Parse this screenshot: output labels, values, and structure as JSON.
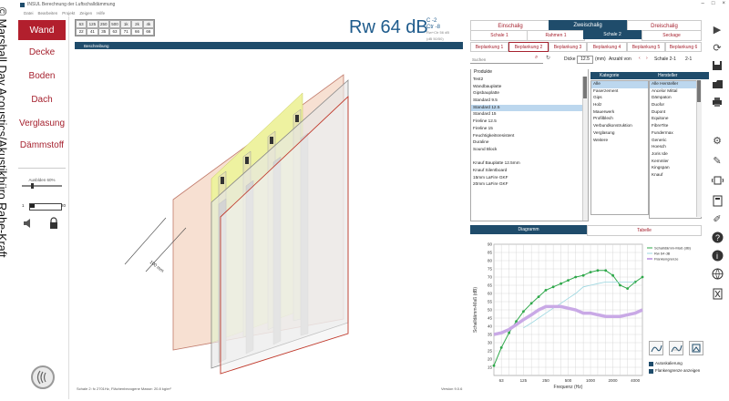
{
  "copyright": "© Marshall Day Acoustics/Akustikbüro Rahe-Kraft",
  "window": {
    "title": "INSUL Berechnung der Luftschalldämmung",
    "menu": [
      "Datei",
      "Bearbeiten",
      "Projekt",
      "Zeigen",
      "Hilfe"
    ]
  },
  "sidebar": {
    "items": [
      "Wand",
      "Decke",
      "Boden",
      "Dach",
      "Verglasung",
      "Dämmstoff"
    ],
    "slider_label": "Ausblden 60%",
    "slider2_min": "1",
    "slider2_max": "20"
  },
  "topgrid": {
    "headers": [
      "63",
      "125",
      "250",
      "500",
      "1k",
      "2k",
      "4k"
    ],
    "values": [
      "22",
      "41",
      "35",
      "63",
      "71",
      "66",
      "66"
    ]
  },
  "rating": {
    "main": "Rw 64 dB",
    "c": "C -2",
    "ctr": "Ctr -8",
    "sub": "Rw+Ctr 56 dB",
    "sub2": "(dB 50/50)"
  },
  "view3d": {
    "header": "Beschreibung",
    "dimension": "100 mm",
    "status": "Schale 2: fc 2701Hz, Flächenbezogene Masse: 20.8 kg/m²",
    "version": "Version 9.0.6"
  },
  "right": {
    "main_tabs": [
      "Einschalig",
      "Zweischalig",
      "Dreischalig"
    ],
    "sub_tabs": [
      "Schale 1",
      "Rahmen 1",
      "Schale 2",
      "Seckage"
    ],
    "layers": [
      "Beplankung 1",
      "Beplankung 2",
      "Beplankung 3",
      "Beplankung 4",
      "Beplankung 5",
      "Beplankung 6"
    ],
    "search_placeholder": "Suchen",
    "dicke_label": "Dicke",
    "dicke_value": "12.5",
    "dicke_unit": "(mm)",
    "anzahl_label": "Anzahl von",
    "anzahl_value": "Schale 2-1",
    "anzahl_suffix": "2-1",
    "products_header": "Produkte",
    "products": [
      "Test2",
      "Wandbauplatte",
      "Gipsbauplatte",
      "Standard 9.5",
      "Standard 12.5",
      "Standard 15",
      "Fireline 12.5",
      "Fireline 15",
      "Feuchtigkeitsresistent",
      "Duraline",
      "Sound Block",
      "",
      "Knauf Bauplatte 12.5mm",
      "Knauf Silentboard",
      "15mm LaFire GKF",
      "20mm LaFire GKF"
    ],
    "products_selected": 4,
    "kategorie_header": "Kategorie",
    "kategorie": [
      "Alle",
      "Faserzement",
      "Gips",
      "Holz",
      "Mauerwerk",
      "Profilblech",
      "Verbundkonstruktion",
      "Verglasung",
      "Weitere"
    ],
    "hersteller_header": "Hersteller",
    "hersteller": [
      "Alle Hersteller",
      "Ancelor Mittal",
      "Dämpaton",
      "Duofor",
      "Dupont",
      "Equitone",
      "FibreTite",
      "Fundermax",
      "Generic",
      "Hoesch",
      "Joris Ide",
      "Kemmler",
      "Kingspan",
      "Knauf"
    ],
    "chart_tabs": [
      "Diagramm",
      "Tabelle"
    ]
  },
  "chart_data": {
    "type": "line",
    "xlabel": "Frequenz (Hz)",
    "ylabel": "Schalldämm-Maß (dB)",
    "x_ticks": [
      "63",
      "125",
      "250",
      "500",
      "1000",
      "2000",
      "4000"
    ],
    "ylim": [
      10,
      90
    ],
    "y_ticks": [
      15,
      20,
      25,
      30,
      35,
      40,
      45,
      50,
      55,
      60,
      65,
      70,
      75,
      80,
      85,
      90
    ],
    "x": [
      50,
      63,
      80,
      100,
      125,
      160,
      200,
      250,
      315,
      400,
      500,
      630,
      800,
      1000,
      1250,
      1600,
      2000,
      2500,
      3150,
      4000,
      5000
    ],
    "series": [
      {
        "name": "Schalldämm-Maß (dB)",
        "color": "#2ea84a",
        "values": [
          16,
          27,
          36,
          43,
          49,
          54,
          58,
          62,
          64,
          66,
          68,
          70,
          71,
          73,
          74,
          74,
          71,
          65,
          63,
          67,
          70
        ]
      },
      {
        "name": "Rw 64 dB",
        "color": "#9bd7e0",
        "values": [
          null,
          null,
          null,
          null,
          39,
          42,
          45,
          48,
          51,
          54,
          57,
          60,
          64,
          65,
          66,
          67,
          67,
          67,
          67,
          67,
          null
        ]
      },
      {
        "name": "Flankengrenze",
        "color": "#c9a9e6",
        "values": [
          35,
          36,
          38,
          41,
          44,
          47,
          50,
          52,
          52,
          52,
          51,
          50,
          48,
          48,
          47,
          46,
          46,
          46,
          47,
          48,
          50
        ]
      }
    ],
    "legend_position": "top-right",
    "grid": true
  },
  "chart_controls": {
    "auto": "Autoskalierung",
    "flank": "Flankengrenze anzeigen"
  }
}
